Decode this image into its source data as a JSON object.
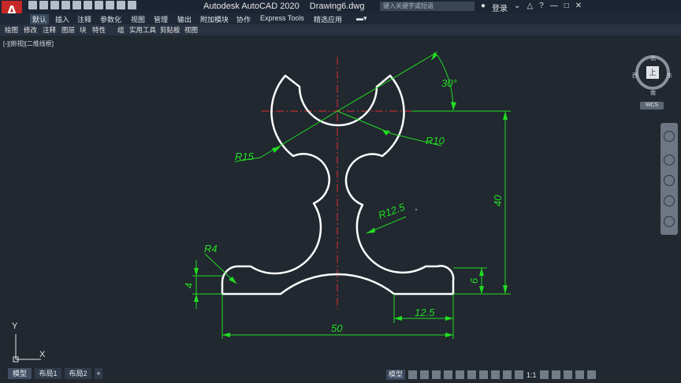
{
  "app": {
    "logo": "A",
    "title": "Autodesk AutoCAD 2020",
    "document": "Drawing6.dwg",
    "search_placeholder": "键入关键字或短语",
    "login": "登录"
  },
  "ribbon_tabs": [
    "默认",
    "插入",
    "注释",
    "参数化",
    "视图",
    "管理",
    "输出",
    "附加模块",
    "协作",
    "Express Tools",
    "精选应用"
  ],
  "panel_labels": [
    "绘图",
    "修改",
    "注释",
    "图层",
    "块",
    "特性",
    "组",
    "实用工具",
    "剪贴板",
    "视图"
  ],
  "viewport": {
    "label": "[-][俯视][二维线框]",
    "compass": {
      "north": "北",
      "south": "南",
      "east": "东",
      "west": "西",
      "face": "上"
    },
    "wcs": "WCS"
  },
  "dimensions": {
    "angle": "30°",
    "r10": "R10",
    "r15": "R15",
    "r12_5": "R12.5",
    "r4": "R4",
    "d40": "40",
    "d6": "6",
    "d4": "4",
    "d12_5": "12.5",
    "d50": "50"
  },
  "ucs": {
    "x": "X",
    "y": "Y"
  },
  "layout_tabs": [
    "模型",
    "布局1",
    "布局2",
    "+"
  ],
  "status": {
    "model": "模型",
    "scale": "1:1"
  },
  "colors": {
    "geometry": "#ffffff",
    "dimension": "#22dd22",
    "centerline": "#e03030",
    "background": "#212830"
  }
}
